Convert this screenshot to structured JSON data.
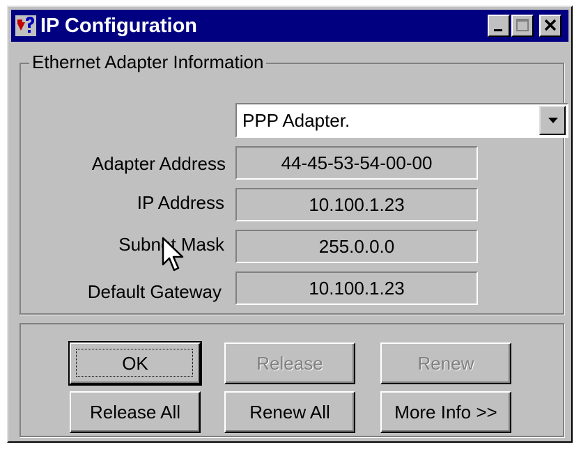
{
  "window": {
    "title": "IP Configuration",
    "title_bar_color": "#000080",
    "icons": [
      "app-icon",
      "minimize-icon",
      "maximize-icon",
      "close-icon"
    ]
  },
  "adapter_group": {
    "legend": "Ethernet  Adapter Information",
    "adapter_select": {
      "selected": "PPP Adapter."
    },
    "fields": [
      {
        "label": "Adapter Address",
        "value": "44-45-53-54-00-00"
      },
      {
        "label": "IP Address",
        "value": "10.100.1.23"
      },
      {
        "label": "Subnet Mask",
        "value": "255.0.0.0"
      },
      {
        "label": "Default Gateway",
        "value": "10.100.1.23"
      }
    ]
  },
  "buttons": {
    "ok": "OK",
    "release": "Release",
    "renew": "Renew",
    "release_all": "Release All",
    "renew_all": "Renew All",
    "more_info": "More Info >>"
  }
}
